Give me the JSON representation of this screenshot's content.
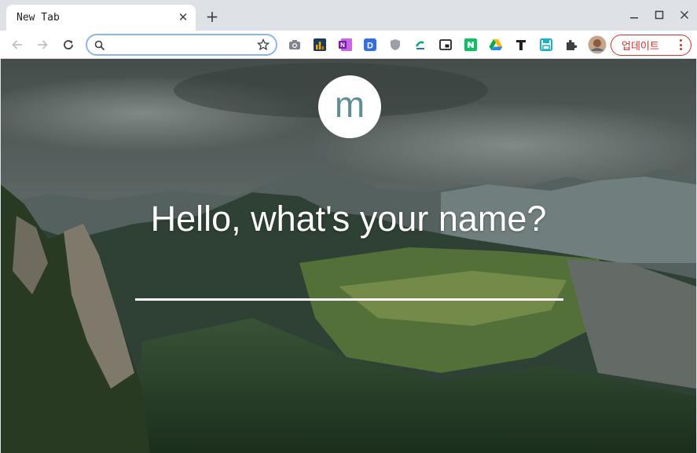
{
  "browser": {
    "tab": {
      "title": "New Tab",
      "close_icon": "close-icon"
    },
    "new_tab_icon": "plus-icon",
    "window_controls": [
      "minimize-icon",
      "maximize-icon",
      "close-icon"
    ],
    "toolbar": {
      "nav_icons": [
        "back-icon",
        "forward-icon",
        "reload-icon"
      ],
      "omnibox": {
        "value": "",
        "search_icon": "search-icon",
        "bookmark_icon": "star-icon"
      },
      "extensions": [
        "camera-icon",
        "bar-chart-icon",
        "onenote-icon",
        "d-icon",
        "shield-icon",
        "green-e-icon",
        "pip-icon",
        "naver-icon",
        "google-drive-icon",
        "text-t-icon",
        "save-icon",
        "puzzle-icon",
        "profile-avatar"
      ],
      "update_button": {
        "label": "업데이트",
        "menu_icon": "more-vert-icon"
      }
    }
  },
  "page": {
    "logo_letter": "m",
    "greeting": "Hello, what's your name?",
    "name_input": {
      "value": ""
    }
  },
  "colors": {
    "accent": "#8ab4f8",
    "update_red": "#d93025",
    "logo_text": "#5f8f93"
  }
}
